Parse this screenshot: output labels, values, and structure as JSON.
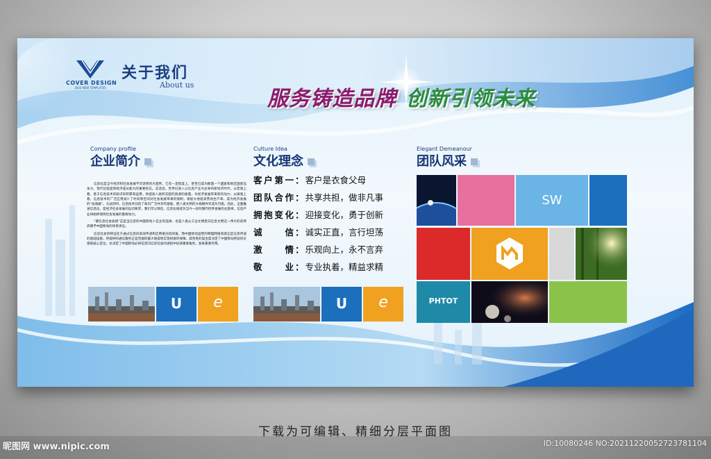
{
  "header": {
    "logo_name": "COVER DESIGN",
    "logo_sub": "2020 NEW TEMPLATES",
    "title_cn": "关于我们",
    "title_en": "About us",
    "slogan_part1": "服务铸造品牌",
    "slogan_part2": "创新引领未来"
  },
  "profile": {
    "en": "Company profile",
    "cn": "企业简介",
    "paragraphs": [
      "信息化是当今经济和社会发展不可逆转的大趋势，它在一定程度上，甚至已成为衡量一个国家和地区国际竞争力、现代化程度和经济成长能力的重要标志。这话说，世界已进入以信息产业为主导的新经济时代。从宏观上看，基于信息技术的知识的积累和运用，将提高人类所支配的资源的质量，为经济发展带来新的动力；从微观上看，信息技术的广泛应用减少了时间和空间对社会发展带来的限制，将极大地提高劳动生产率，成为经济发展的“加速器”。与此同时，信息技术创造了知识广泛共享的基础，使人类文明的大规模共享成为可能。因此，全面推进信息化，是经济社会发展的迫切要求，我们可以预见，信息化将成为当今一段时期内世界发展的主旋律，信息产业将始终保持社会发展的重要动力。",
      "“健信息社会核建”这是当信息的中国移动人在主的选择，也是人类从工业文明走向信息文明这一伟大的史转折期予中国移动的项目责任。",
      "信息社会的特征在于通过信息的高效传递和应用来创造财富。而中国移动运营的物理网络资源正是信息传递的基础设施，所提供的通信服务正是普遍的最大限度地实现财富的保障。其完善的契合度决定了中国移动所处的价值链核心定位，也决定了中国移动必将在走向信息社会的进程中扮演重要角色，发挥重要作用。"
    ]
  },
  "culture": {
    "en": "Culture Idea",
    "cn": "文化理念",
    "items": [
      {
        "key": "客户第一",
        "value": "客户是衣食父母"
      },
      {
        "key": "团队合作",
        "value": "共享共担，做非凡事"
      },
      {
        "key": "拥抱变化",
        "value": "迎接变化，勇于创新"
      },
      {
        "key": "诚信",
        "value": "诚实正直，言行坦荡"
      },
      {
        "key": "激情",
        "value": "乐观向上，永不言弃"
      },
      {
        "key": "敬业",
        "value": "专业执着，精益求精"
      }
    ],
    "colon": "："
  },
  "team": {
    "en": "Elegant Demeanour",
    "cn": "团队风采",
    "tile_sw": "SW",
    "tile_photo": "PHTOT"
  },
  "strips": {
    "letter_u": "U",
    "letter_e": "e"
  },
  "footer": {
    "caption": "下载为可编辑、精细分层平面图",
    "watermark_left": "昵图网 www.nipic.com",
    "watermark_right": "ID:10080246 NO:20211220052723781104"
  },
  "colors": {
    "blue": "#1b6fbd",
    "orange": "#f0a120",
    "pink": "#e7719e",
    "sky": "#6ab4e6",
    "red": "#dc2a2a",
    "gray": "#d8d8d8",
    "teal": "#1e8aa8",
    "green": "#8bc34a"
  }
}
